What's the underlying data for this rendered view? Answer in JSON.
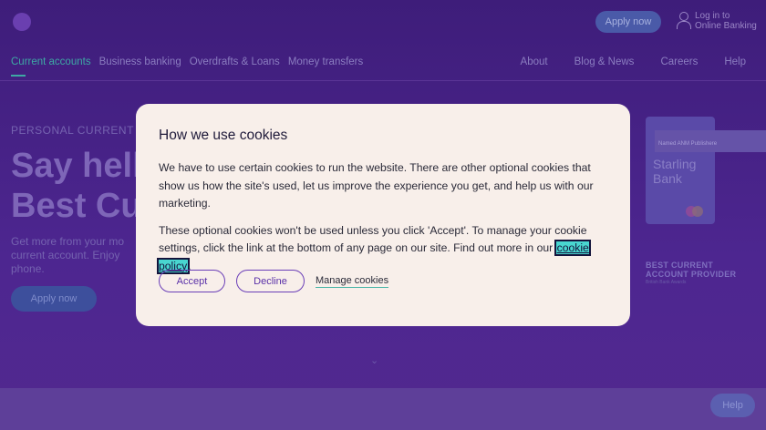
{
  "header": {
    "apply_label": "Apply now",
    "login_line1": "Log in to",
    "login_line2": "Online Banking"
  },
  "nav": {
    "left": [
      "Current accounts",
      "Business banking",
      "Overdrafts & Loans",
      "Money transfers"
    ],
    "right": [
      "About",
      "Blog & News",
      "Careers",
      "Help"
    ]
  },
  "hero": {
    "eyebrow": "PERSONAL CURRENT A",
    "title_line1": "Say hello",
    "title_line2": "Best Cu",
    "subtitle_line1": "Get more from your mo",
    "subtitle_line2": "current account. Enjoy",
    "subtitle_line3": "phone.",
    "apply_label": "Apply now"
  },
  "card": {
    "brand_line1": "Starling",
    "brand_line2": "Bank",
    "tag": "Named ANM Publishere"
  },
  "award": {
    "line1": "BEST CURRENT",
    "line2": "ACCOUNT PROVIDER",
    "sub": "British Bank Awards"
  },
  "footer": {
    "help_label": "Help"
  },
  "cookie_modal": {
    "title": "How we use cookies",
    "para1": "We have to use certain cookies to run the website. There are other optional cookies that show us how the site's used, let us improve the experience you get, and help us with our marketing.",
    "para2_prefix": "These optional cookies won't be used unless you click 'Accept'. To manage your cookie settings, click the link at the bottom of any page on our site. Find out more in our ",
    "policy_link": "cookie policy",
    "para2_suffix": ".",
    "accept_label": "Accept",
    "decline_label": "Decline",
    "manage_label": "Manage cookies"
  },
  "colors": {
    "page_bg": "#4a2185",
    "modal_bg": "#f8efea",
    "button_accent": "#6b3fb8",
    "link_highlight": "#49d6d0",
    "nav_active": "#3ea8a4"
  }
}
